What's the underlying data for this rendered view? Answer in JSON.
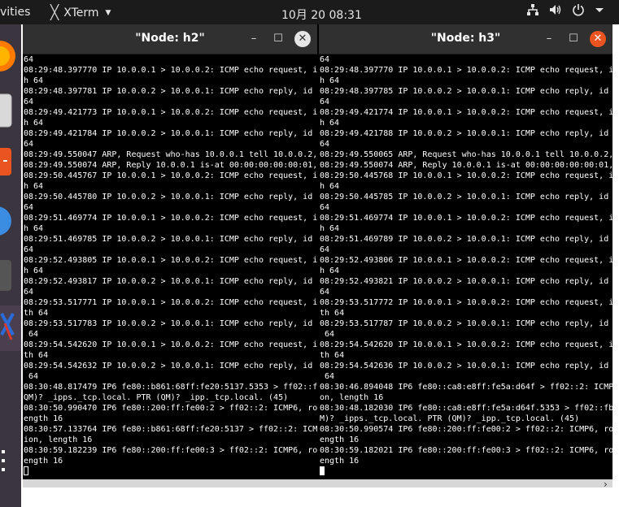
{
  "topbar": {
    "activities": "vities",
    "app_name": "XTerm",
    "clock": "10月 20  08:31",
    "icons": [
      "network-icon",
      "volume-icon",
      "power-icon",
      "chevron-down-icon"
    ]
  },
  "dock": {
    "apps": [
      "firefox-icon",
      "files-icon",
      "software-icon",
      "help-icon",
      "terminal-icon",
      "xterm-icon",
      "show-apps-icon"
    ]
  },
  "windows": [
    {
      "title": "\"Node: h2\"",
      "close_color": "#e6e6e6",
      "lines": [
        "64",
        "08:29:48.397770 IP 10.0.0.1 > 10.0.0.2: ICMP echo request, i",
        "h 64",
        "08:29:48.397781 IP 10.0.0.2 > 10.0.0.1: ICMP echo reply, id",
        "64",
        "08:29:49.421773 IP 10.0.0.1 > 10.0.0.2: ICMP echo request, i",
        "h 64",
        "08:29:49.421784 IP 10.0.0.2 > 10.0.0.1: ICMP echo reply, id",
        "64",
        "08:29:49.550047 ARP, Request who-has 10.0.0.1 tell 10.0.0.2,",
        "08:29:49.550074 ARP, Reply 10.0.0.1 is-at 00:00:00:00:00:01,",
        "08:29:50.445767 IP 10.0.0.1 > 10.0.0.2: ICMP echo request, i",
        "h 64",
        "08:29:50.445780 IP 10.0.0.2 > 10.0.0.1: ICMP echo reply, id",
        "64",
        "08:29:51.469774 IP 10.0.0.1 > 10.0.0.2: ICMP echo request, i",
        "h 64",
        "08:29:51.469785 IP 10.0.0.2 > 10.0.0.1: ICMP echo reply, id",
        "64",
        "08:29:52.493805 IP 10.0.0.1 > 10.0.0.2: ICMP echo request, i",
        "h 64",
        "08:29:52.493817 IP 10.0.0.2 > 10.0.0.1: ICMP echo reply, id",
        "64",
        "08:29:53.517771 IP 10.0.0.1 > 10.0.0.2: ICMP echo request, i",
        "th 64",
        "08:29:53.517783 IP 10.0.0.2 > 10.0.0.1: ICMP echo reply, id",
        " 64",
        "08:29:54.542620 IP 10.0.0.1 > 10.0.0.2: ICMP echo request, i",
        "th 64",
        "08:29:54.542632 IP 10.0.0.2 > 10.0.0.1: ICMP echo reply, id",
        " 64",
        "08:30:48.817479 IP6 fe80::b861:68ff:fe20:5137.5353 > ff02::f",
        "QM)? _ipps._tcp.local. PTR (QM)? _ipp._tcp.local. (45)",
        "08:30:50.990470 IP6 fe80::200:ff:fe00:2 > ff02::2: ICMP6, ro",
        "ength 16",
        "08:30:57.133764 IP6 fe80::b861:68ff:fe20:5137 > ff02::2: ICM",
        "ion, length 16",
        "08:30:59.182239 IP6 fe80::200:ff:fe00:3 > ff02::2: ICMP6, ro",
        "ength 16"
      ]
    },
    {
      "title": "\"Node: h3\"",
      "close_color": "#e95420",
      "lines": [
        "64",
        "08:29:48.397770 IP 10.0.0.1 > 10.0.0.2: ICMP echo request, i",
        "h 64",
        "08:29:48.397785 IP 10.0.0.2 > 10.0.0.1: ICMP echo reply, id",
        "64",
        "08:29:49.421774 IP 10.0.0.1 > 10.0.0.2: ICMP echo request, i",
        "h 64",
        "08:29:49.421788 IP 10.0.0.2 > 10.0.0.1: ICMP echo reply, id",
        "64",
        "08:29:49.550065 ARP, Request who-has 10.0.0.1 tell 10.0.0.2,",
        "08:29:49.550074 ARP, Reply 10.0.0.1 is-at 00:00:00:00:00:01,",
        "08:29:50.445768 IP 10.0.0.1 > 10.0.0.2: ICMP echo request, i",
        "h 64",
        "08:29:50.445785 IP 10.0.0.2 > 10.0.0.1: ICMP echo reply, id",
        "64",
        "08:29:51.469774 IP 10.0.0.1 > 10.0.0.2: ICMP echo request, i",
        "h 64",
        "08:29:51.469789 IP 10.0.0.2 > 10.0.0.1: ICMP echo reply, id",
        "64",
        "08:29:52.493806 IP 10.0.0.1 > 10.0.0.2: ICMP echo request, i",
        "h 64",
        "08:29:52.493821 IP 10.0.0.2 > 10.0.0.1: ICMP echo reply, id",
        "64",
        "08:29:53.517772 IP 10.0.0.1 > 10.0.0.2: ICMP echo request, i",
        "th 64",
        "08:29:53.517787 IP 10.0.0.2 > 10.0.0.1: ICMP echo reply, id",
        " 64",
        "08:29:54.542620 IP 10.0.0.1 > 10.0.0.2: ICMP echo request, i",
        "th 64",
        "08:29:54.542636 IP 10.0.0.2 > 10.0.0.1: ICMP echo reply, id",
        " 64",
        "08:30:46.894048 IP6 fe80::ca8:e8ff:fe5a:d64f > ff02::2: ICMP",
        "on, length 16",
        "08:30:48.182030 IP6 fe80::ca8:e8ff:fe5a:d64f.5353 > ff02::fb",
        "M)? _ipps._tcp.local. PTR (QM)? _ipp._tcp.local. (45)",
        "08:30:50.990574 IP6 fe80::200:ff:fe00:2 > ff02::2: ICMP6, ro",
        "ength 16",
        "08:30:59.182021 IP6 fe80::200:ff:fe00:3 > ff02::2: ICMP6, ro",
        "ength 16"
      ]
    }
  ]
}
